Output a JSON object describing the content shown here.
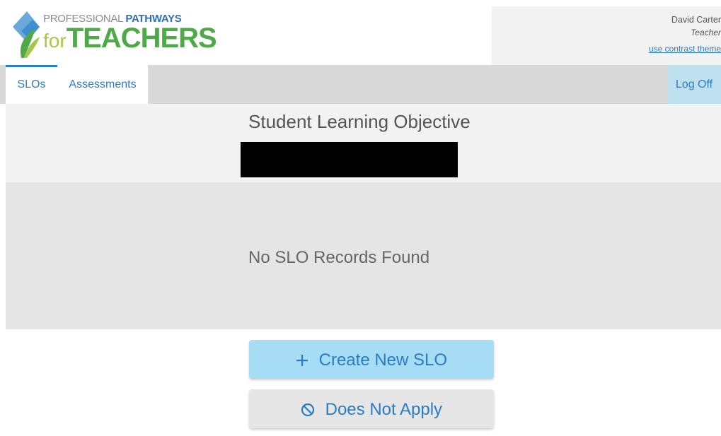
{
  "header": {
    "logo": {
      "line1_word1": "PROFESSIONAL",
      "line1_word2": "PATHWAYS",
      "line2_for": "for",
      "line2_teachers": "TEACHERS"
    },
    "user": {
      "name": "David Carter",
      "role": "Teacher",
      "contrast_link": "use contrast theme"
    }
  },
  "nav": {
    "tabs": [
      {
        "label": "SLOs",
        "active": true
      },
      {
        "label": "Assessments",
        "active": false
      }
    ],
    "logoff_label": "Log Off"
  },
  "main": {
    "title": "Student Learning Objective",
    "empty_message": "No SLO Records Found",
    "create_button": {
      "icon": "plus-icon",
      "label": "Create New SLO"
    },
    "does_not_apply_button": {
      "icon": "prohibited-icon",
      "label": "Does Not Apply"
    }
  },
  "colors": {
    "accent": "#2a7cc4",
    "brand_green": "#4eaa47",
    "create_button_bg": "#a6dcf4",
    "logoff_bg": "#bfe0ef"
  }
}
